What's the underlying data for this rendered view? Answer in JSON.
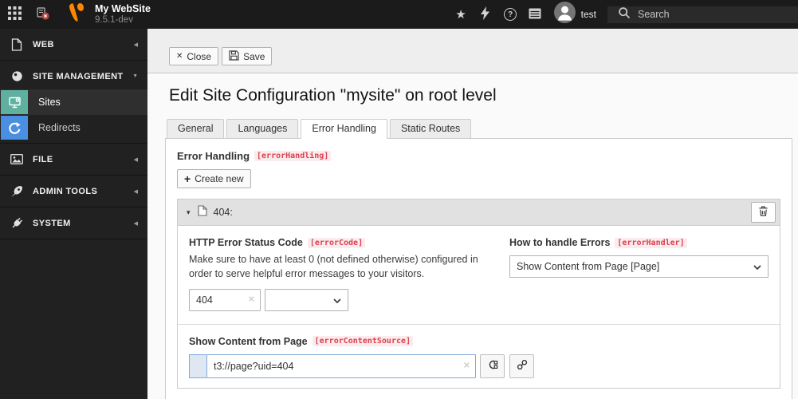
{
  "topbar": {
    "app_title": "My WebSite",
    "app_version": "9.5.1-dev",
    "username": "test",
    "search_placeholder": "Search"
  },
  "sidebar": {
    "sections": [
      {
        "label": "WEB",
        "state": "collapsed"
      },
      {
        "label": "SITE MANAGEMENT",
        "state": "expanded"
      },
      {
        "label": "FILE",
        "state": "collapsed"
      },
      {
        "label": "ADMIN TOOLS",
        "state": "collapsed"
      },
      {
        "label": "SYSTEM",
        "state": "collapsed"
      }
    ],
    "site_management_items": [
      {
        "label": "Sites",
        "active": true
      },
      {
        "label": "Redirects",
        "active": false
      }
    ]
  },
  "docheader": {
    "close_label": "Close",
    "save_label": "Save"
  },
  "page": {
    "title": "Edit Site Configuration \"mysite\" on root level"
  },
  "tabs": [
    {
      "label": "General"
    },
    {
      "label": "Languages"
    },
    {
      "label": "Error Handling",
      "active": true
    },
    {
      "label": "Static Routes"
    }
  ],
  "form": {
    "section_title": "Error Handling",
    "section_badge": "[errorHandling]",
    "create_new_label": "Create new",
    "error_item": {
      "header_label": "404:",
      "error_code": {
        "label": "HTTP Error Status Code",
        "badge": "[errorCode]",
        "description": "Make sure to have at least 0 (not defined otherwise) configured in order to serve helpful error messages to your visitors.",
        "value": "404",
        "select_value": ""
      },
      "error_handler": {
        "label": "How to handle Errors",
        "badge": "[errorHandler]",
        "value": "Show Content from Page [Page]"
      },
      "error_content_source": {
        "label": "Show Content from Page",
        "badge": "[errorContentSource]",
        "value": "t3://page?uid=404"
      }
    }
  },
  "colors": {
    "typo3_orange": "#ff8700",
    "sites_teal": "#5fb0a0",
    "redirects_blue": "#4a8fe2",
    "badge_red": "#d9414e",
    "badge_bg": "#fcebed",
    "topbar_bg": "#1b1b1b",
    "sidebar_bg": "#212121"
  }
}
